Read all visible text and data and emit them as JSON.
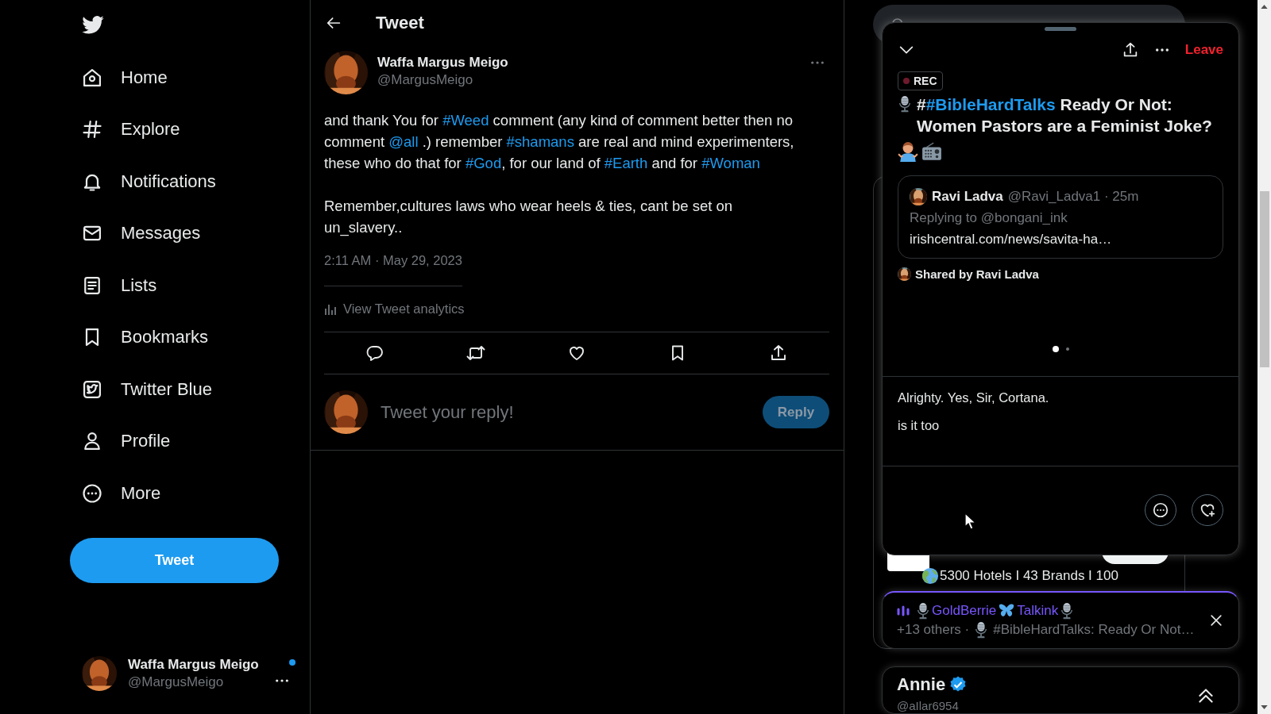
{
  "sidebar": {
    "nav": [
      {
        "kind": "home",
        "label": "Home"
      },
      {
        "kind": "explore",
        "label": "Explore"
      },
      {
        "kind": "notifications",
        "label": "Notifications"
      },
      {
        "kind": "messages",
        "label": "Messages"
      },
      {
        "kind": "lists",
        "label": "Lists"
      },
      {
        "kind": "bookmarks",
        "label": "Bookmarks"
      },
      {
        "kind": "blue",
        "label": "Twitter Blue"
      },
      {
        "kind": "profile",
        "label": "Profile"
      },
      {
        "kind": "more",
        "label": "More"
      }
    ],
    "tweet_button": "Tweet",
    "account": {
      "name": "Waffa Margus Meigo",
      "handle": "@MargusMeigo",
      "unread": true
    }
  },
  "main": {
    "header": {
      "title": "Tweet"
    },
    "tweet": {
      "author": {
        "name": "Waffa Margus Meigo",
        "handle": "@MargusMeigo"
      },
      "paragraphs": [
        [
          {
            "kind": "text",
            "text": "and thank You for "
          },
          {
            "kind": "link",
            "text": "#Weed"
          },
          {
            "kind": "text",
            "text": " comment (any kind of comment better then no comment "
          },
          {
            "kind": "link",
            "text": "@all"
          },
          {
            "kind": "text",
            "text": " .) remember "
          },
          {
            "kind": "link",
            "text": "#shamans"
          },
          {
            "kind": "text",
            "text": " are real and mind experimenters, these who do that for "
          },
          {
            "kind": "link",
            "text": "#God"
          },
          {
            "kind": "text",
            "text": ", for our land of "
          },
          {
            "kind": "link",
            "text": "#Earth"
          },
          {
            "kind": "text",
            "text": " and for "
          },
          {
            "kind": "link",
            "text": "#Woman"
          }
        ],
        [
          {
            "kind": "text",
            "text": "Remember,cultures laws who wear heels & ties, cant be set on un_slavery.."
          }
        ]
      ],
      "timestamp": "2:11 AM · May 29, 2023",
      "analytics": "View Tweet analytics"
    },
    "reply": {
      "placeholder": "Tweet your reply!",
      "button": {
        "label": "Reply",
        "disabled": true
      }
    }
  },
  "right": {
    "follow": {
      "bio": "5300 Hotels I 43 Brands I 100"
    },
    "space": {
      "leave": "Leave",
      "rec": "REC",
      "title": {
        "prefix": "#",
        "tag": "#BibleHardTalks",
        "rest": " Ready Or Not: Women Pastors are a Feminist Joke?"
      },
      "quote": {
        "name": "Ravi Ladva",
        "meta": "@Ravi_Ladva1 · 25m",
        "replying": "Replying to @bongani_ink",
        "link": "irishcentral.com/news/savita-ha…"
      },
      "shared_by": "Shared by Ravi Ladva",
      "carousel_dots": [
        {
          "selected": true
        },
        {
          "selected": false
        }
      ],
      "captions": [
        "Alrighty. Yes, Sir, Cortana.",
        "is it too"
      ]
    },
    "mini_bar": {
      "host_parts": [
        "GoldBerrie",
        "Talkink"
      ],
      "others": "+13 others ·",
      "title": "#BibleHardTalks: Ready Or Not…"
    },
    "profile_card": {
      "name": "Annie",
      "verified": true,
      "handle": "@aIlar6954"
    }
  }
}
